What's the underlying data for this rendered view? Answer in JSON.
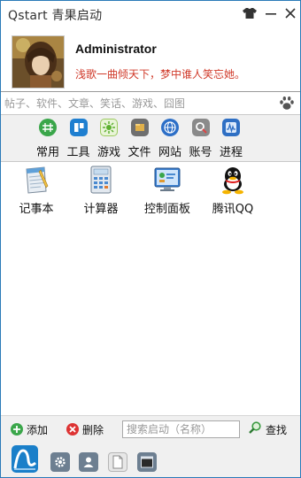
{
  "window": {
    "title": "Qstart 青果启动",
    "buttons": [
      "shirt-icon",
      "minimize-icon",
      "close-icon"
    ]
  },
  "profile": {
    "username": "Administrator",
    "motto": "浅歌一曲倾天下，梦中谁人笑忘她。"
  },
  "search": {
    "placeholder": "帖子、软件、文章、笑话、游戏、囧图",
    "icon": "paw-icon"
  },
  "categories": [
    {
      "label": "常用",
      "icon": "common-icon",
      "color": "#3aa64a"
    },
    {
      "label": "工具",
      "icon": "tools-icon",
      "color": "#1f7fd0"
    },
    {
      "label": "游戏",
      "icon": "game-icon",
      "color": "#5cb030"
    },
    {
      "label": "文件",
      "icon": "file-icon",
      "color": "#c99a3a"
    },
    {
      "label": "网站",
      "icon": "globe-icon",
      "color": "#2d6fc7"
    },
    {
      "label": "账号",
      "icon": "account-icon",
      "color": "#777777"
    },
    {
      "label": "进程",
      "icon": "process-icon",
      "color": "#2e6fc4"
    }
  ],
  "apps": [
    {
      "name": "记事本",
      "icon": "notepad-icon"
    },
    {
      "name": "计算器",
      "icon": "calculator-icon"
    },
    {
      "name": "控制面板",
      "icon": "control-panel-icon"
    },
    {
      "name": "腾讯QQ",
      "icon": "qq-icon"
    }
  ],
  "actions": {
    "add_label": "添加",
    "delete_label": "删除",
    "find_placeholder": "搜索启动（名称）",
    "find_label": "查找"
  },
  "dock": [
    "qstart-logo-icon",
    "settings-icon",
    "user-icon",
    "document-icon",
    "terminal-icon"
  ],
  "colors": {
    "border": "#2a7ab8",
    "motto": "#d03a2a",
    "dock_logo": "#1a7fc9"
  }
}
